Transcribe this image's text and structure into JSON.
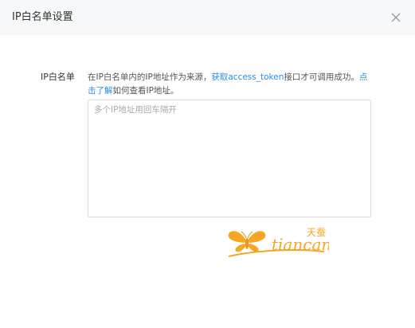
{
  "dialog": {
    "title": "IP白名单设置"
  },
  "form": {
    "label": "IP白名单",
    "description": {
      "text_before": "在IP白名单内的IP地址作为来源，",
      "link_access_token": "获取access_token",
      "text_middle": "接口才可调用成功。",
      "link_help": "点击了解",
      "text_after": "如何查看IP地址。"
    },
    "textarea": {
      "value": "",
      "placeholder": "多个IP地址用回车隔开"
    }
  },
  "watermark": {
    "chinese": "天蚕",
    "latin": "tiancan"
  },
  "colors": {
    "header_bg": "#f7f8fa",
    "link": "#2b8de8",
    "watermark": "#f5a623"
  },
  "icons": {
    "close": "close-icon",
    "watermark": "butterfly-icon"
  }
}
